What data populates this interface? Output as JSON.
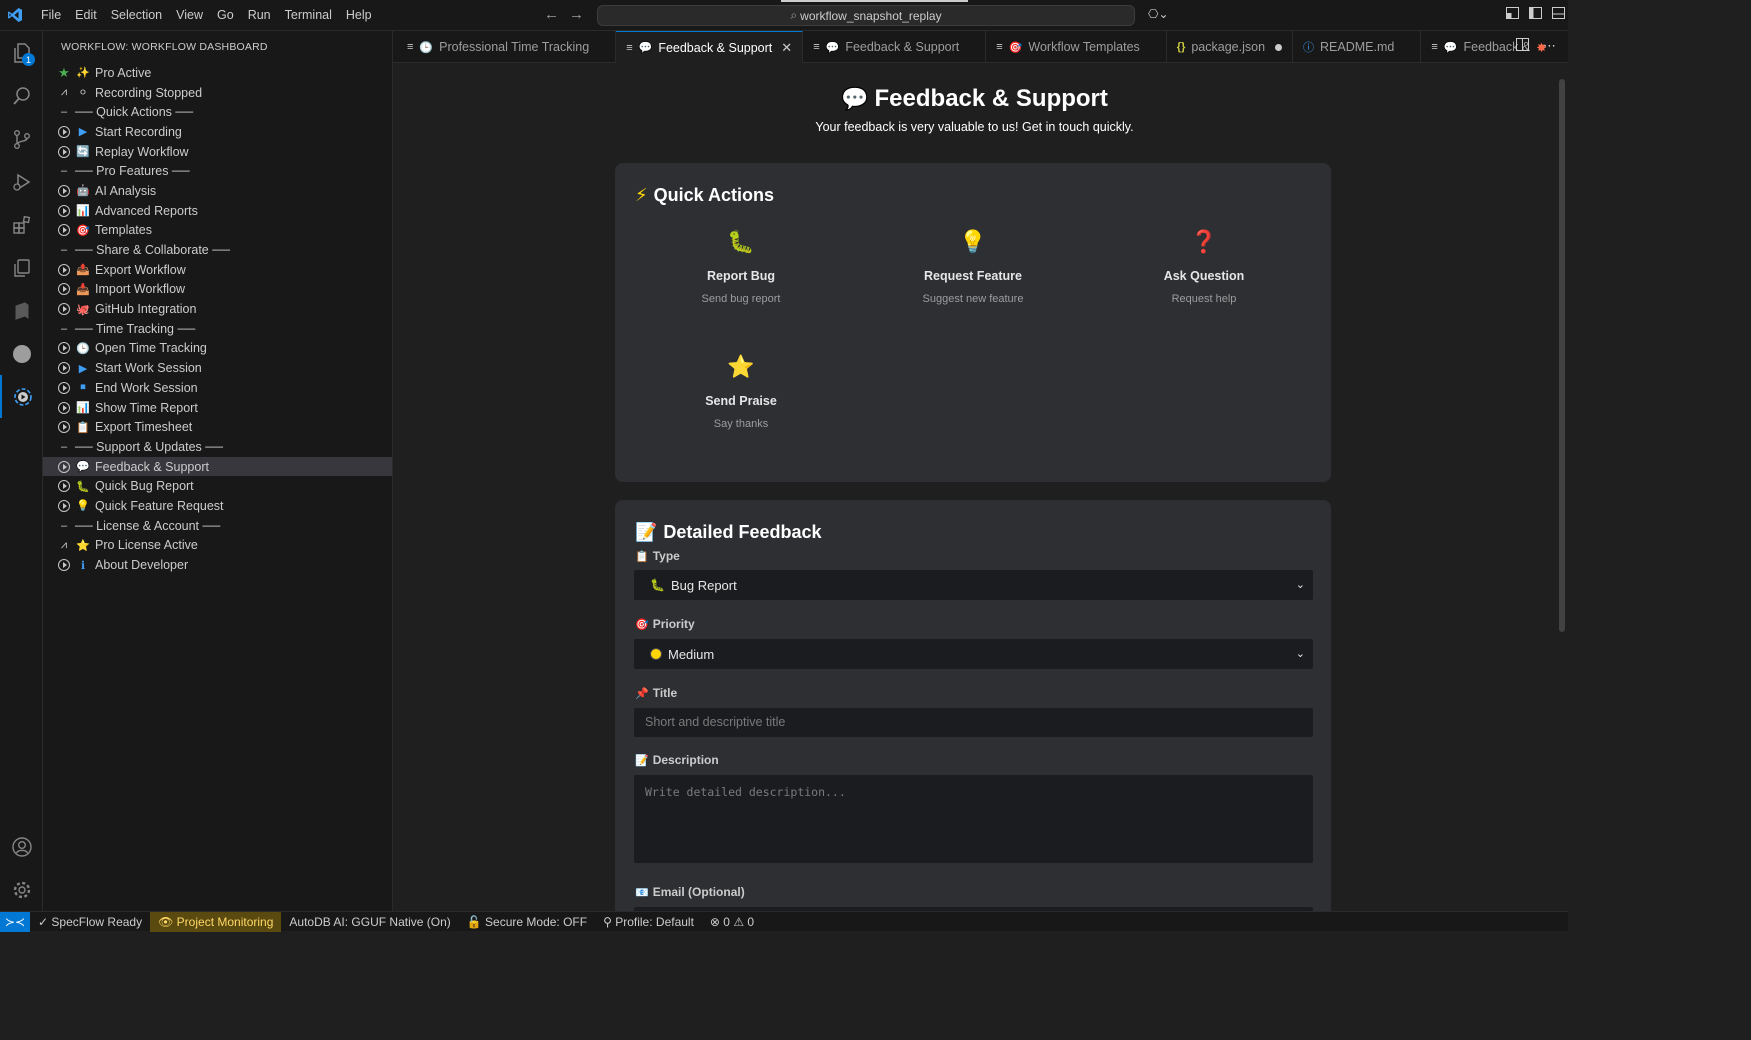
{
  "titlebar": {
    "menu": [
      "File",
      "Edit",
      "Selection",
      "View",
      "Go",
      "Run",
      "Terminal",
      "Help"
    ],
    "search_text": "workflow_snapshot_replay"
  },
  "activity": {
    "explorer_badge": "1"
  },
  "sidebar": {
    "title": "WORKFLOW: WORKFLOW DASHBOARD",
    "items": [
      {
        "lead": "star",
        "emoji": "✨",
        "label": "Pro Active"
      },
      {
        "lead": "pulse",
        "emoji": "⚪",
        "label": "Recording Stopped"
      },
      {
        "lead": "dash",
        "emoji": "",
        "label": "── Quick Actions ──"
      },
      {
        "lead": "play",
        "emoji": "▶",
        "label": "Start Recording"
      },
      {
        "lead": "play",
        "emoji": "🔄",
        "label": "Replay Workflow"
      },
      {
        "lead": "dash",
        "emoji": "",
        "label": "── Pro Features ──"
      },
      {
        "lead": "play",
        "emoji": "🤖",
        "label": "AI Analysis"
      },
      {
        "lead": "play",
        "emoji": "📊",
        "label": "Advanced Reports"
      },
      {
        "lead": "play",
        "emoji": "🎯",
        "label": "Templates"
      },
      {
        "lead": "dash",
        "emoji": "",
        "label": "── Share & Collaborate ──"
      },
      {
        "lead": "play",
        "emoji": "📤",
        "label": "Export Workflow"
      },
      {
        "lead": "play",
        "emoji": "📥",
        "label": "Import Workflow"
      },
      {
        "lead": "play",
        "emoji": "🐙",
        "label": "GitHub Integration"
      },
      {
        "lead": "dash",
        "emoji": "",
        "label": "── Time Tracking ──"
      },
      {
        "lead": "play",
        "emoji": "🕒",
        "label": "Open Time Tracking"
      },
      {
        "lead": "play",
        "emoji": "▶",
        "label": "Start Work Session"
      },
      {
        "lead": "play",
        "emoji": "⏹",
        "label": "End Work Session"
      },
      {
        "lead": "play",
        "emoji": "📊",
        "label": "Show Time Report"
      },
      {
        "lead": "play",
        "emoji": "📋",
        "label": "Export Timesheet"
      },
      {
        "lead": "dash",
        "emoji": "",
        "label": "── Support & Updates ──"
      },
      {
        "lead": "play",
        "emoji": "💬",
        "label": "Feedback & Support"
      },
      {
        "lead": "play",
        "emoji": "🐛",
        "label": "Quick Bug Report"
      },
      {
        "lead": "play",
        "emoji": "💡",
        "label": "Quick Feature Request"
      },
      {
        "lead": "dash",
        "emoji": "",
        "label": "── License & Account ──"
      },
      {
        "lead": "pulse",
        "emoji": "⭐",
        "label": "Pro License Active"
      },
      {
        "lead": "play",
        "emoji": "ℹ",
        "label": "About Developer"
      }
    ]
  },
  "tabs": [
    {
      "icon": "🕒",
      "label": "Professional Time Tracking"
    },
    {
      "icon": "💬",
      "label": "Feedback & Support"
    },
    {
      "icon": "💬",
      "label": "Feedback & Support"
    },
    {
      "icon": "🎯",
      "label": "Workflow Templates"
    },
    {
      "icon": "{}",
      "label": "package.json"
    },
    {
      "icon": "ⓘ",
      "label": "README.md"
    },
    {
      "icon": "💬",
      "label": "Feedback &"
    }
  ],
  "page": {
    "title_icon": "💬",
    "title": "Feedback & Support",
    "subtitle": "Your feedback is very valuable to us! Get in touch quickly.",
    "quick_actions": {
      "icon": "⚡",
      "title": "Quick Actions",
      "items": [
        {
          "icon": "🐛",
          "title": "Report Bug",
          "desc": "Send bug report"
        },
        {
          "icon": "💡",
          "title": "Request Feature",
          "desc": "Suggest new feature"
        },
        {
          "icon": "❓",
          "title": "Ask Question",
          "desc": "Request help"
        },
        {
          "icon": "⭐",
          "title": "Send Praise",
          "desc": "Say thanks"
        }
      ]
    },
    "detailed": {
      "icon": "📝",
      "title": "Detailed Feedback",
      "type_label": "Type",
      "type_value": "Bug Report",
      "type_value_icon": "🐛",
      "priority_label": "Priority",
      "priority_value": "Medium",
      "title_label": "Title",
      "title_placeholder": "Short and descriptive title",
      "description_label": "Description",
      "description_placeholder": "Write detailed description...",
      "email_label": "Email (Optional)"
    }
  },
  "statusbar": {
    "items": [
      "✓ SpecFlow Ready",
      "👁 Project Monitoring",
      "AutoDB AI: GGUF Native (On)",
      "🔓 Secure Mode: OFF",
      "⚲ Profile: Default",
      "⊗ 0 ⚠ 0"
    ]
  },
  "colors": {
    "accent": "#0078d4",
    "card": "#2d2f33",
    "editor_bg": "#1f1f1f"
  }
}
